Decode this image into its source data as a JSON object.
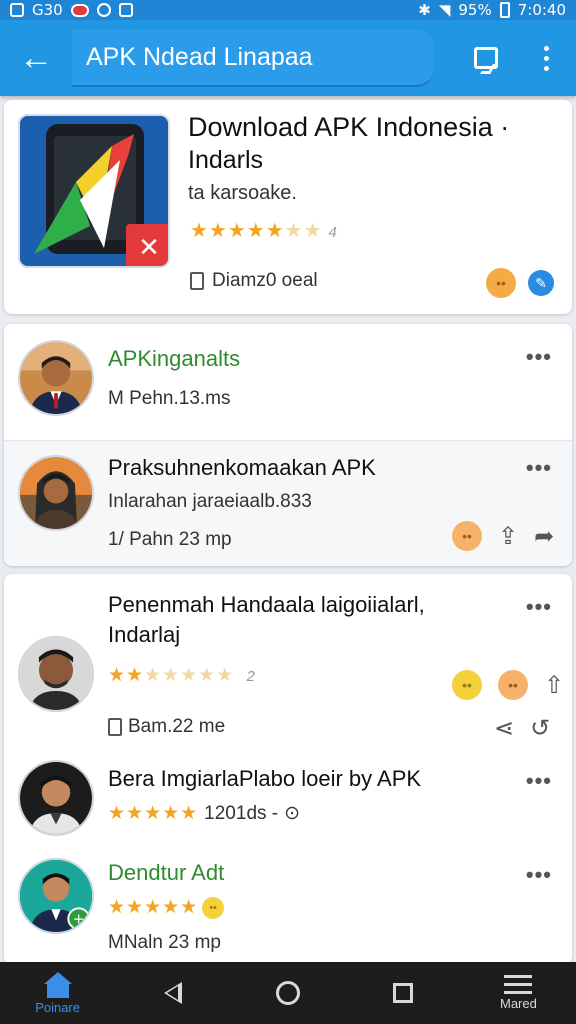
{
  "status_bar": {
    "left_text": "G30",
    "battery": "95%",
    "time": "7:0:40"
  },
  "app_bar": {
    "title": "APK Ndead Linapaa"
  },
  "hero": {
    "title": "Download APK Indonesia ·",
    "subtitle": "Indarls",
    "meta": "ta karsoake.",
    "rating_count": "4",
    "footer_text": "Diamz0 oeal"
  },
  "rows": [
    {
      "title": "APKinganalts",
      "subtitle": "M Pehn.13.ms"
    },
    {
      "title": "Praksuhnenkomaakan APK",
      "subtitle": "Inlarahan jaraeiaalb.833",
      "time": "1/ Pahn 23 mp"
    },
    {
      "title_line1": "Penenmah Handaala laigoiialarl,",
      "title_line2": "Indarlaj",
      "rating_value": "2",
      "time": "Bam.22 me"
    },
    {
      "title": "Bera ImgiarlaPlabo loeir by APK",
      "meta": "1201ds -"
    },
    {
      "title": "Dendtur Adt",
      "time": "MNaln 23 mp"
    }
  ],
  "nav": {
    "home_label": "Poinare",
    "menu_label": "Mared"
  },
  "colors": {
    "app_bar": "#2196e3",
    "status_bar": "#1f86d6",
    "star": "#f2a423",
    "green_title": "#2e8b2e",
    "nav_bg": "#1d1d1d"
  },
  "icons": [
    "back-arrow-icon",
    "message-icon",
    "more-vertical-icon",
    "star-icon",
    "emoji-icon",
    "share-icon",
    "forward-icon",
    "home-icon"
  ]
}
